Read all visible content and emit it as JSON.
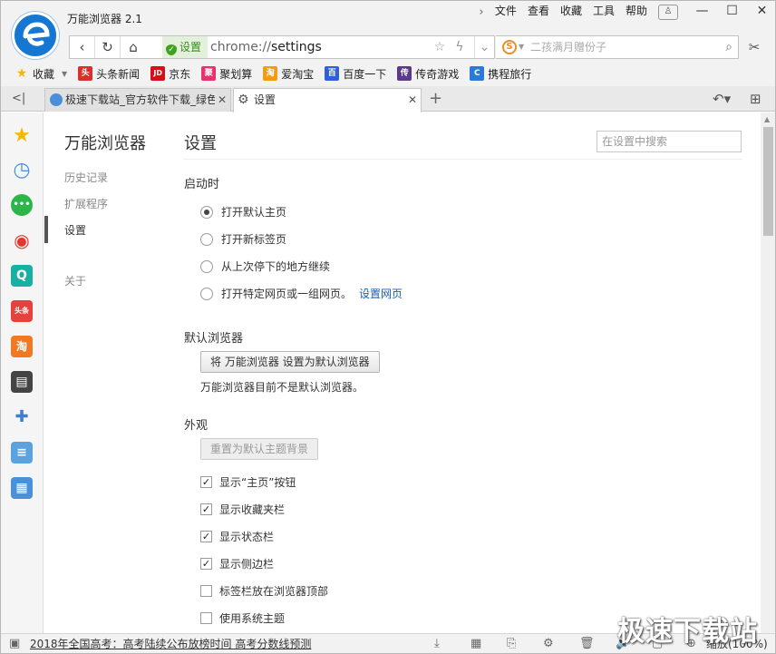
{
  "window": {
    "title": "万能浏览器 2.1",
    "menu": [
      "文件",
      "查看",
      "收藏",
      "工具",
      "帮助"
    ],
    "controls": {
      "minimize": "—",
      "maximize": "☐",
      "close": "✕"
    }
  },
  "address_bar": {
    "secure_label": "设置",
    "url_scheme": "chrome://",
    "url_path": "settings"
  },
  "search_box": {
    "placeholder": "二孩满月赠份子"
  },
  "bookmarks": {
    "favorites_label": "收藏",
    "items": [
      {
        "label": "头条新闻",
        "color": "#d9302c",
        "glyph": "头"
      },
      {
        "label": "京东",
        "color": "#d40f17",
        "glyph": "JD"
      },
      {
        "label": "聚划算",
        "color": "#e6336b",
        "glyph": "聚"
      },
      {
        "label": "爱淘宝",
        "color": "#f39c12",
        "glyph": "淘"
      },
      {
        "label": "百度一下",
        "color": "#2f60d7",
        "glyph": "百"
      },
      {
        "label": "传奇游戏",
        "color": "#5b3a8c",
        "glyph": "传"
      },
      {
        "label": "携程旅行",
        "color": "#2a7ad6",
        "glyph": "C"
      }
    ]
  },
  "tabs": [
    {
      "label": "极速下载站_官方软件下载_绿色",
      "active": false
    },
    {
      "label": "设置",
      "active": true
    }
  ],
  "sidebar_icons": [
    {
      "name": "star-icon",
      "color": "#f5b800",
      "glyph": "★"
    },
    {
      "name": "history-clock-icon",
      "color": "#4a90d9",
      "glyph": "◷"
    },
    {
      "name": "wechat-icon",
      "color": "#2cb64a",
      "glyph": "●"
    },
    {
      "name": "weibo-icon",
      "color": "#e5352c",
      "glyph": "◉"
    },
    {
      "name": "search-app-icon",
      "color": "#18b0a3",
      "glyph": "Q"
    },
    {
      "name": "toutiao-icon",
      "color": "#e8413b",
      "glyph": "头条"
    },
    {
      "name": "taobao-icon",
      "color": "#f07a23",
      "glyph": "淘"
    },
    {
      "name": "video-icon",
      "color": "#444444",
      "glyph": "▤"
    },
    {
      "name": "game-controller-icon",
      "color": "#3e7dcc",
      "glyph": "✚"
    },
    {
      "name": "notes-icon",
      "color": "#5ba3df",
      "glyph": "≡"
    },
    {
      "name": "calculator-icon",
      "color": "#4a90d9",
      "glyph": "▦"
    }
  ],
  "settings_nav": {
    "title": "万能浏览器",
    "items": [
      "历史记录",
      "扩展程序",
      "设置"
    ],
    "about": "关于"
  },
  "settings": {
    "title": "设置",
    "search_placeholder": "在设置中搜索",
    "startup": {
      "heading": "启动时",
      "options": [
        "打开默认主页",
        "打开新标签页",
        "从上次停下的地方继续",
        "打开特定网页或一组网页。"
      ],
      "selected_index": 0,
      "set_pages_link": "设置网页"
    },
    "default_browser": {
      "heading": "默认浏览器",
      "button": "将 万能浏览器 设置为默认浏览器",
      "status": "万能浏览器目前不是默认浏览器。"
    },
    "appearance": {
      "heading": "外观",
      "reset_theme_button": "重置为默认主题背景",
      "checkboxes": [
        {
          "label": "显示“主页”按钮",
          "checked": true
        },
        {
          "label": "显示收藏夹栏",
          "checked": true
        },
        {
          "label": "显示状态栏",
          "checked": true
        },
        {
          "label": "显示侧边栏",
          "checked": true
        },
        {
          "label": "标签栏放在浏览器顶部",
          "checked": false
        },
        {
          "label": "使用系统主题",
          "checked": false
        }
      ]
    }
  },
  "status_bar": {
    "news": "2018年全国高考：高考陆续公布放榜时间 高考分数线预测",
    "zoom": "缩放(100%)"
  },
  "watermark": "极速下载站"
}
